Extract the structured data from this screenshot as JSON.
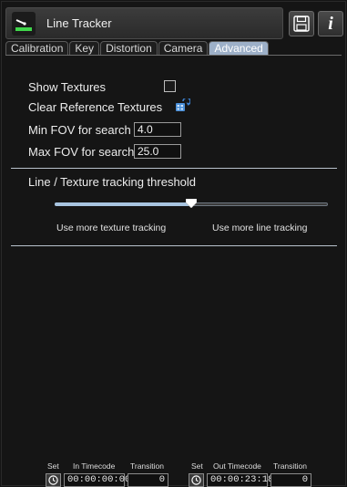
{
  "app": {
    "title": "Line Tracker",
    "app_icon": "line-tracker-icon",
    "save_icon": "floppy-disk-icon",
    "info_icon": "info-icon",
    "info_glyph": "i"
  },
  "tabs": [
    {
      "label": "Calibration",
      "active": false
    },
    {
      "label": "Key",
      "active": false
    },
    {
      "label": "Distortion",
      "active": false
    },
    {
      "label": "Camera",
      "active": false
    },
    {
      "label": "Advanced",
      "active": true
    }
  ],
  "settings": {
    "show_textures_label": "Show Textures",
    "show_textures_checked": false,
    "clear_ref_label": "Clear Reference Textures",
    "clear_ref_icon": "refresh-icon",
    "min_fov_label": "Min FOV for search",
    "min_fov_value": "4.0",
    "max_fov_label": "Max FOV for search",
    "max_fov_value": "25.0"
  },
  "threshold": {
    "title": "Line / Texture tracking threshold",
    "left_label": "Use more texture tracking",
    "right_label": "Use more line tracking",
    "value": 0.5
  },
  "timecode": {
    "in": {
      "set_label": "Set",
      "timecode_label": "In Timecode",
      "transition_label": "Transition",
      "timecode_value": "00:00:00:00",
      "transition_value": "0"
    },
    "out": {
      "set_label": "Set",
      "timecode_label": "Out Timecode",
      "transition_label": "Transition",
      "timecode_value": "00:00:23:18",
      "transition_value": "0"
    },
    "clock_icon": "clock-icon"
  },
  "colors": {
    "active_tab": "#9db0c8",
    "background": "#151515",
    "slider_fill": "#a8c4e0"
  }
}
